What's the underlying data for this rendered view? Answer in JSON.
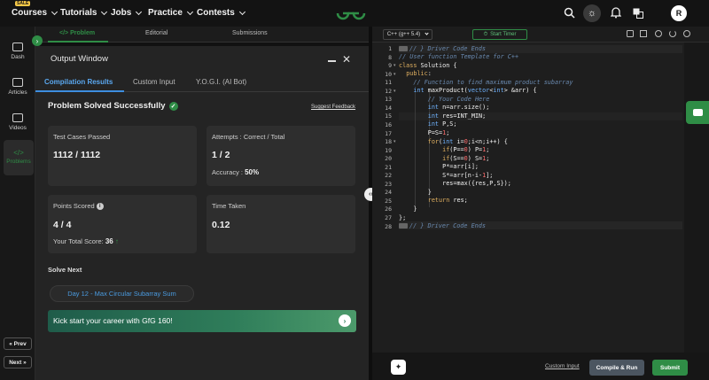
{
  "topnav": {
    "sale_badge": "SALE",
    "items": [
      {
        "label": "Courses"
      },
      {
        "label": "Tutorials"
      },
      {
        "label": "Jobs"
      },
      {
        "label": "Practice"
      },
      {
        "label": "Contests"
      }
    ],
    "avatar_initial": "R",
    "icons": [
      "search-icon",
      "theme-toggle-icon",
      "bell-icon",
      "translate-icon"
    ]
  },
  "sidebar": {
    "items": [
      {
        "label": "Dash",
        "icon": "dashboard-icon"
      },
      {
        "label": "Articles",
        "icon": "article-icon"
      },
      {
        "label": "Videos",
        "icon": "video-icon"
      },
      {
        "label": "Problems",
        "icon": "code-icon",
        "active": true
      }
    ],
    "prev_label": "« Prev",
    "next_label": "Next »"
  },
  "problem_tabs": {
    "problem": "</> Problem",
    "editorial": "Editorial",
    "submissions": "Submissions"
  },
  "output": {
    "title": "Output Window",
    "tabs": [
      "Compilation Results",
      "Custom Input",
      "Y.O.G.I. (AI Bot)"
    ],
    "status": "Problem Solved Successfully",
    "feedback_link": "Suggest Feedback",
    "test_cases_label": "Test Cases Passed",
    "test_cases_value": "1112 / 1112",
    "attempts_label": "Attempts : Correct / Total",
    "attempts_value": "1 / 2",
    "accuracy_label": "Accuracy :",
    "accuracy_value": "50%",
    "points_label": "Points Scored",
    "points_value": "4 / 4",
    "total_score_label": "Your Total Score:",
    "total_score_value": "36",
    "time_label": "Time Taken",
    "time_value": "0.12",
    "solve_next": "Solve Next",
    "next_problem": "Day 12 - Max Circular Subarray Sum",
    "banner_text": "Kick start your career with GfG 160!"
  },
  "editor": {
    "language": "C++ (g++ 5.4)",
    "timer": "Start Timer",
    "custom_input": "Custom Input",
    "compile_run": "Compile & Run",
    "submit": "Submit",
    "lines": [
      {
        "n": "1",
        "text": "// } Driver Code Ends"
      },
      {
        "n": "8",
        "text": "// User function Template for C++"
      },
      {
        "n": "9",
        "text": "class Solution {"
      },
      {
        "n": "10",
        "text": "  public:"
      },
      {
        "n": "11",
        "text": "    // Function to find maximum product subarray"
      },
      {
        "n": "12",
        "text": "    int maxProduct(vector<int> &arr) {"
      },
      {
        "n": "13",
        "text": "        // Your Code Here"
      },
      {
        "n": "14",
        "text": "        int n=arr.size();"
      },
      {
        "n": "15",
        "text": "        int res=INT_MIN;"
      },
      {
        "n": "16",
        "text": "        int P,S;"
      },
      {
        "n": "17",
        "text": "        P=S=1;"
      },
      {
        "n": "18",
        "text": "        for(int i=0;i<n;i++) {"
      },
      {
        "n": "19",
        "text": "            if(P==0) P=1;"
      },
      {
        "n": "20",
        "text": "            if(S==0) S=1;"
      },
      {
        "n": "21",
        "text": "            P*=arr[i];"
      },
      {
        "n": "22",
        "text": "            S*=arr[n-i-1];"
      },
      {
        "n": "23",
        "text": "            res=max({res,P,S});"
      },
      {
        "n": "24",
        "text": "        }"
      },
      {
        "n": "25",
        "text": "        return res;"
      },
      {
        "n": "26",
        "text": "    }"
      },
      {
        "n": "27",
        "text": "};"
      },
      {
        "n": "28",
        "text": "// } Driver Code Ends"
      }
    ]
  },
  "colors": {
    "accent_green": "#2f8d46",
    "link_blue": "#5aa8f0",
    "background": "#242424"
  }
}
